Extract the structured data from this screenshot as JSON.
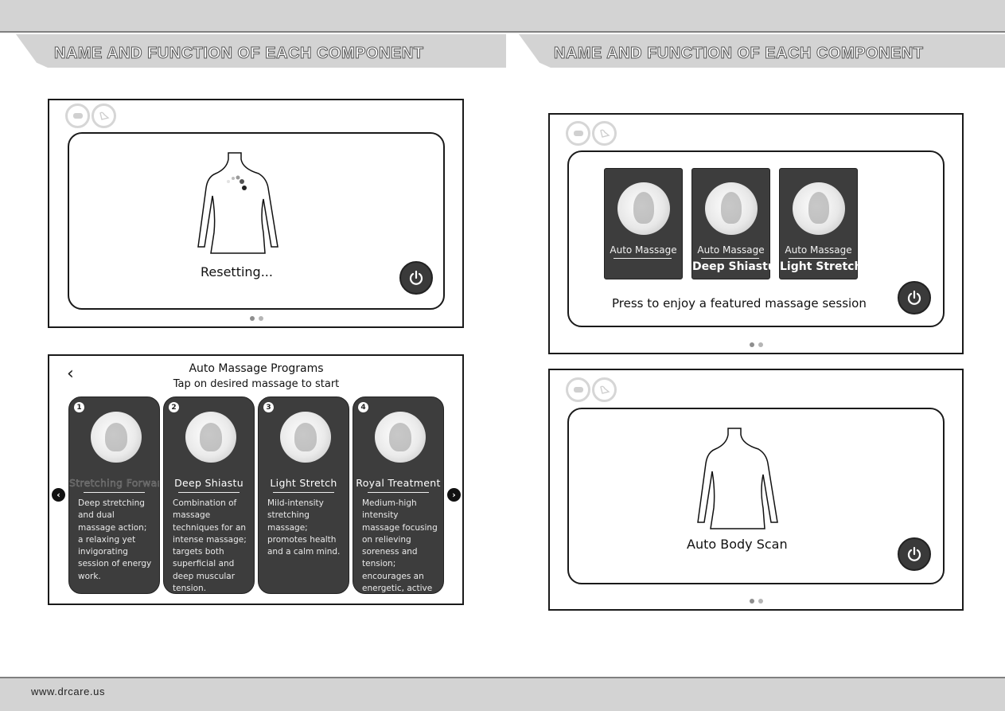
{
  "header": {
    "left_title": "NAME AND FUNCTION OF EACH COMPONENT",
    "right_title": "NAME AND FUNCTION OF EACH COMPONENT"
  },
  "footer": {
    "url": "www.drcare.us"
  },
  "screens": {
    "resetting": {
      "status_text": "Resetting...",
      "status_icons": [
        "battery-icon",
        "no-recline-icon"
      ],
      "page_dots": {
        "count": 2,
        "active": 1
      }
    },
    "programs": {
      "title": "Auto Massage Programs",
      "subtitle": "Tap on desired massage to start",
      "back_icon": "‹",
      "prev_icon": "‹",
      "next_icon": "›",
      "cards": [
        {
          "number": "1",
          "name": "Stretching Forward",
          "description": "Deep stretching and dual massage action; a relaxing yet invigorating session of energy work."
        },
        {
          "number": "2",
          "name": "Deep Shiastu",
          "description": "Combination of massage techniques for an intense massage; targets both superficial and deep muscular tension."
        },
        {
          "number": "3",
          "name": "Light Stretch",
          "description": "Mild-intensity stretching massage; promotes health and a calm mind."
        },
        {
          "number": "4",
          "name": "Royal Treatment",
          "description": "Medium-high intensity massage focusing on relieving soreness and tension; encourages an energetic, active attitude."
        }
      ]
    },
    "featured": {
      "prompt": "Press to enjoy a featured massage session",
      "cards": [
        {
          "label": "Auto Massage",
          "name": ""
        },
        {
          "label": "Auto Massage",
          "name": "Deep Shiastu"
        },
        {
          "label": "Auto Massage",
          "name": "Light Stretch"
        }
      ],
      "page_dots": {
        "count": 2,
        "active": 1
      }
    },
    "body_scan": {
      "status_text": "Auto Body Scan",
      "page_dots": {
        "count": 2,
        "active": 1
      }
    }
  },
  "colors": {
    "band_gray": "#d3d3d3",
    "rule_gray": "#808080",
    "card_dark": "#3d3d3d",
    "power_button": "#3a3a3a"
  }
}
